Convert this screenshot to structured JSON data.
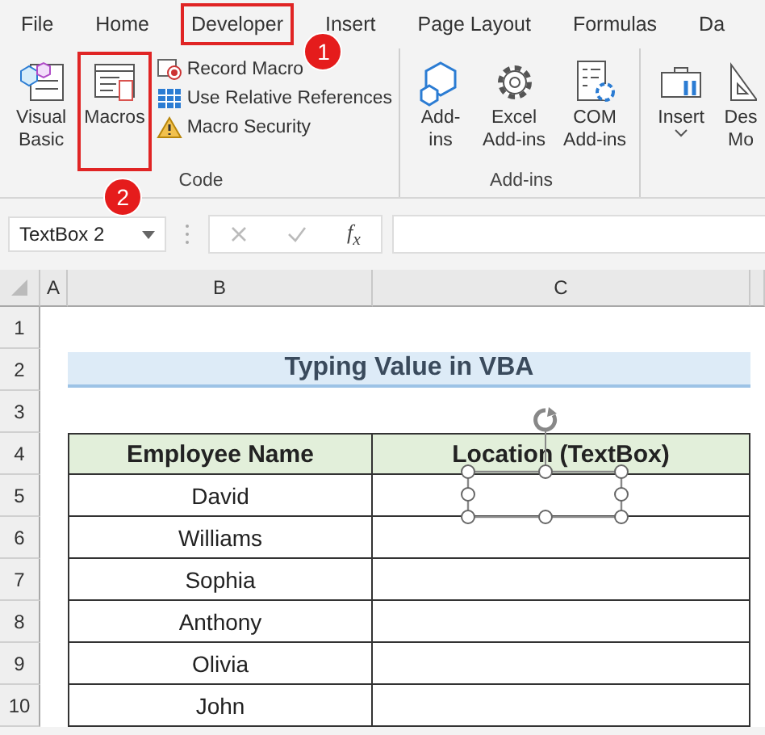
{
  "tabs": [
    {
      "label": "File",
      "selected": false
    },
    {
      "label": "Home",
      "selected": false
    },
    {
      "label": "Developer",
      "selected": true,
      "badge": "1"
    },
    {
      "label": "Insert",
      "selected": false
    },
    {
      "label": "Page Layout",
      "selected": false
    },
    {
      "label": "Formulas",
      "selected": false
    },
    {
      "label": "Da",
      "selected": false
    }
  ],
  "ribbon": {
    "groups": [
      {
        "label": "Code",
        "large_buttons": [
          {
            "kind": "visual-basic",
            "lines": [
              "Visual",
              "Basic"
            ],
            "highlighted": false,
            "dropdown": false
          },
          {
            "kind": "macros",
            "lines": [
              "Macros"
            ],
            "highlighted": true,
            "badge": "2",
            "dropdown": false
          }
        ],
        "small_buttons": [
          {
            "kind": "record",
            "label": "Record Macro"
          },
          {
            "kind": "relative",
            "label": "Use Relative References"
          },
          {
            "kind": "security",
            "label": "Macro Security"
          }
        ]
      },
      {
        "label": "Add-ins",
        "large_buttons": [
          {
            "kind": "addins",
            "lines": [
              "Add-",
              "ins"
            ],
            "highlighted": false,
            "dropdown": false
          },
          {
            "kind": "gear",
            "lines": [
              "Excel",
              "Add-ins"
            ],
            "highlighted": false,
            "dropdown": false
          },
          {
            "kind": "com",
            "lines": [
              "COM",
              "Add-ins"
            ],
            "highlighted": false,
            "dropdown": false
          }
        ]
      },
      {
        "large_buttons": [
          {
            "kind": "toolbox",
            "lines": [
              "Insert"
            ],
            "highlighted": false,
            "dropdown": true
          },
          {
            "kind": "ruler",
            "lines": [
              "Des",
              "Mo"
            ],
            "highlighted": false,
            "dropdown": false
          }
        ]
      }
    ]
  },
  "formula_bar": {
    "name_box": "TextBox 2",
    "fx": "f$_{x}$"
  },
  "sheet": {
    "columns": [
      "A",
      "B",
      "C"
    ],
    "rows": [
      "1",
      "2",
      "3",
      "4",
      "5",
      "6",
      "7",
      "8",
      "9",
      "10"
    ],
    "title": "Typing Value in VBA",
    "table": {
      "headers": [
        "Employee Name",
        "Location (TextBox)"
      ],
      "names": [
        "David",
        "Williams",
        "Sophia",
        "Anthony",
        "Olivia",
        "John"
      ]
    }
  },
  "textbox": {
    "selected": true
  }
}
